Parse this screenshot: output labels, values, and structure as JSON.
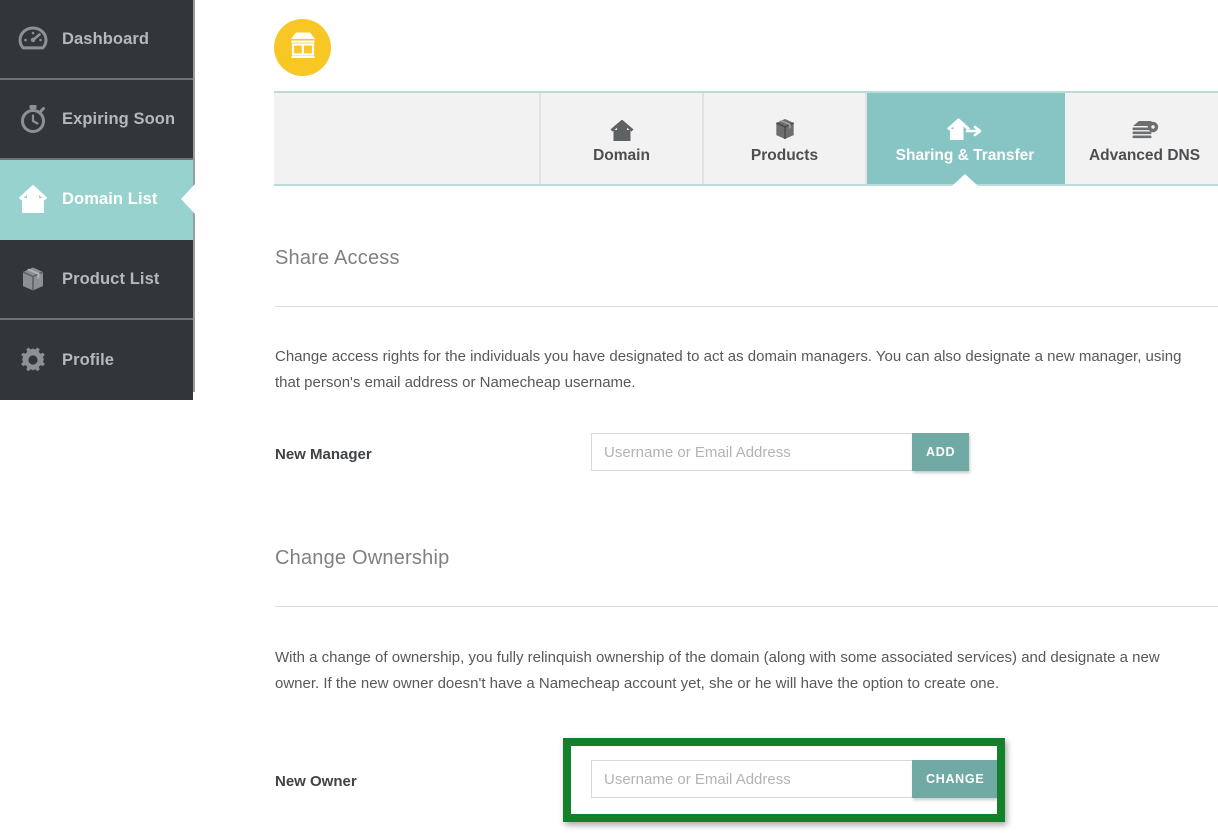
{
  "sidebar": {
    "items": [
      {
        "label": "Dashboard",
        "icon": "speedometer-icon",
        "active": false
      },
      {
        "label": "Expiring Soon",
        "icon": "stopwatch-icon",
        "active": false
      },
      {
        "label": "Domain List",
        "icon": "house-icon",
        "active": true
      },
      {
        "label": "Product List",
        "icon": "box-icon",
        "active": false
      },
      {
        "label": "Profile",
        "icon": "gear-icon",
        "active": false
      }
    ]
  },
  "header": {
    "avatar_icon": "storefront-icon",
    "avatar_color": "#f8c725"
  },
  "tabs": {
    "active_color": "#86c5c4",
    "items": [
      {
        "label": "",
        "icon": "",
        "active": false
      },
      {
        "label": "Domain",
        "icon": "house-icon",
        "active": false
      },
      {
        "label": "Products",
        "icon": "box-icon",
        "active": false
      },
      {
        "label": "Sharing & Transfer",
        "icon": "house-arrow-icon",
        "active": true
      },
      {
        "label": "Advanced DNS",
        "icon": "server-gear-icon",
        "active": false
      }
    ]
  },
  "share_access": {
    "title": "Share Access",
    "description": "Change access rights for the individuals you have designated to act as domain managers. You can also designate a new manager, using that person's email address or Namecheap username.",
    "field_label": "New Manager",
    "placeholder": "Username or Email Address",
    "input_value": "",
    "button_label": "ADD"
  },
  "change_ownership": {
    "title": "Change Ownership",
    "description": "With a change of ownership, you fully relinquish ownership of the domain (along with some associated services) and designate a new owner. If the new owner doesn't have a Namecheap account yet, she or he will have the option to create one.",
    "field_label": "New Owner",
    "placeholder": "Username or Email Address",
    "input_value": "",
    "button_label": "CHANGE"
  },
  "annotation": {
    "name": "new-owner-highlight",
    "color": "#13802a"
  }
}
